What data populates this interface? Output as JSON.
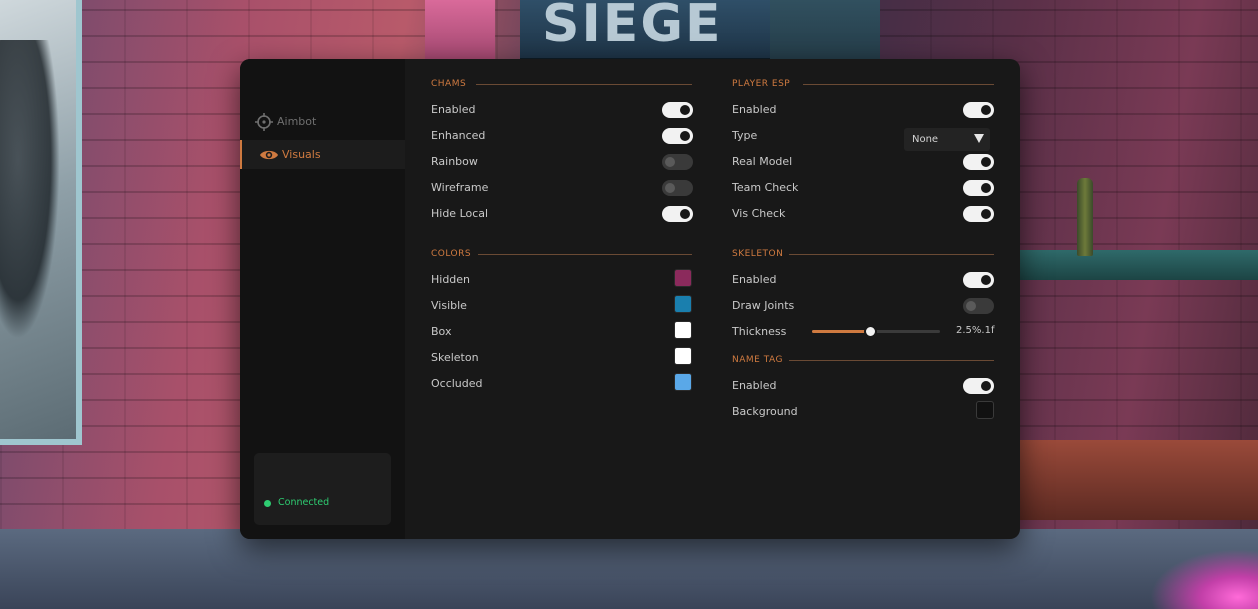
{
  "sidebar": {
    "items": [
      {
        "label": "Aimbot",
        "icon": "crosshair-icon",
        "active": false
      },
      {
        "label": "Visuals",
        "icon": "eye-icon",
        "active": true
      }
    ],
    "status": {
      "label": "Connected",
      "color": "#2ecc71"
    }
  },
  "chams": {
    "title": "CHAMS",
    "rows": [
      {
        "label": "Enabled",
        "value": true
      },
      {
        "label": "Enhanced",
        "value": true
      },
      {
        "label": "Rainbow",
        "value": false
      },
      {
        "label": "Wireframe",
        "value": false
      },
      {
        "label": "Hide Local",
        "value": true
      }
    ]
  },
  "colors": {
    "title": "COLORS",
    "rows": [
      {
        "label": "Hidden",
        "color": "#8b2a5c"
      },
      {
        "label": "Visible",
        "color": "#1a7fae"
      },
      {
        "label": "Box",
        "color": "#ffffff"
      },
      {
        "label": "Skeleton",
        "color": "#ffffff"
      },
      {
        "label": "Occluded",
        "color": "#5aa8e8"
      }
    ]
  },
  "player_esp": {
    "title": "PLAYER ESP",
    "enabled": {
      "label": "Enabled",
      "value": true
    },
    "type": {
      "label": "Type",
      "selected": "None"
    },
    "rows": [
      {
        "label": "Real Model",
        "value": true
      },
      {
        "label": "Team Check",
        "value": true
      },
      {
        "label": "Vis Check",
        "value": true
      }
    ]
  },
  "skeleton": {
    "title": "SKELETON",
    "rows": [
      {
        "label": "Enabled",
        "value": true
      },
      {
        "label": "Draw Joints",
        "value": false
      }
    ],
    "thickness": {
      "label": "Thickness",
      "value_text": "2.5%.1f",
      "fraction": 0.45
    }
  },
  "name_tag": {
    "title": "NAME TAG",
    "enabled": {
      "label": "Enabled",
      "value": true
    },
    "background": {
      "label": "Background",
      "color": "#111111"
    }
  },
  "accent_color": "#cf7a40",
  "background_sign": "SIEGE"
}
